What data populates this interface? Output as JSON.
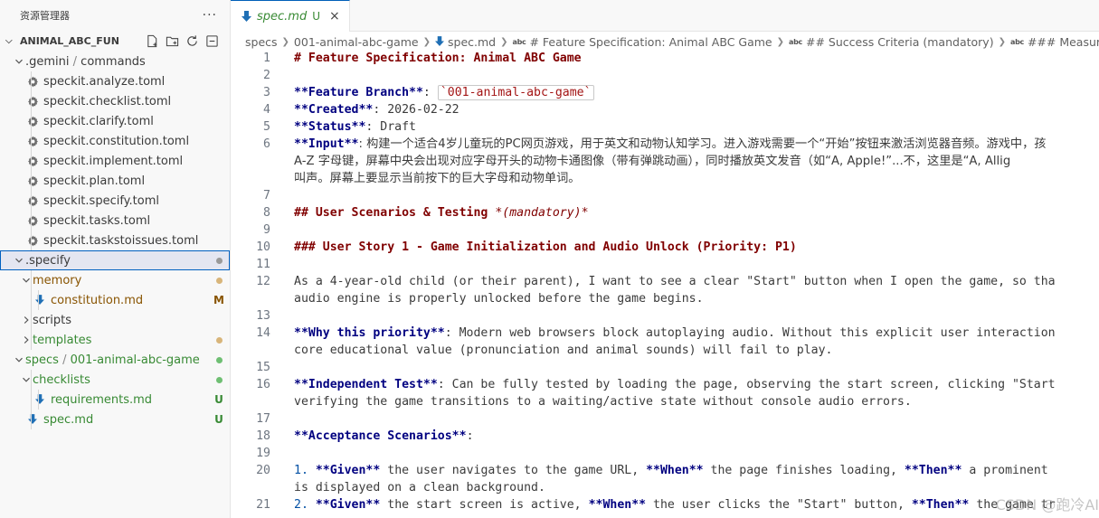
{
  "explorer": {
    "title": "资源管理器",
    "more": "···",
    "root": "ANIMAL_ABC_FUN",
    "tree": [
      {
        "label": ".gemini",
        "label2": "commands",
        "type": "folder",
        "open": true,
        "depth": 1,
        "color": "",
        "badge": ""
      },
      {
        "label": "speckit.analyze.toml",
        "type": "gear",
        "depth": 2
      },
      {
        "label": "speckit.checklist.toml",
        "type": "gear",
        "depth": 2
      },
      {
        "label": "speckit.clarify.toml",
        "type": "gear",
        "depth": 2
      },
      {
        "label": "speckit.constitution.toml",
        "type": "gear",
        "depth": 2
      },
      {
        "label": "speckit.implement.toml",
        "type": "gear",
        "depth": 2
      },
      {
        "label": "speckit.plan.toml",
        "type": "gear",
        "depth": 2
      },
      {
        "label": "speckit.specify.toml",
        "type": "gear",
        "depth": 2
      },
      {
        "label": "speckit.tasks.toml",
        "type": "gear",
        "depth": 2
      },
      {
        "label": "speckit.taskstoissues.toml",
        "type": "gear",
        "depth": 2
      },
      {
        "label": ".specify",
        "type": "folder",
        "open": true,
        "depth": 1,
        "selected": true,
        "dot": "gray"
      },
      {
        "label": "memory",
        "type": "folder",
        "open": true,
        "depth": 2,
        "color": "orange",
        "dot": "orange"
      },
      {
        "label": "constitution.md",
        "type": "md",
        "depth": 3,
        "color": "orange",
        "badge": "M"
      },
      {
        "label": "scripts",
        "type": "folder",
        "open": false,
        "depth": 2
      },
      {
        "label": "templates",
        "type": "folder",
        "open": false,
        "depth": 2,
        "color": "green",
        "dot": "orange"
      },
      {
        "label": "specs",
        "label2": "001-animal-abc-game",
        "type": "folder",
        "open": true,
        "depth": 1,
        "color": "green",
        "dot": "green"
      },
      {
        "label": "checklists",
        "type": "folder",
        "open": true,
        "depth": 2,
        "color": "green",
        "dot": "green"
      },
      {
        "label": "requirements.md",
        "type": "md",
        "depth": 3,
        "color": "green",
        "badge": "U"
      },
      {
        "label": "spec.md",
        "type": "md",
        "depth": 2,
        "color": "green",
        "badge": "U"
      }
    ]
  },
  "tab": {
    "name": "spec.md",
    "status": "U",
    "close": "×"
  },
  "breadcrumb": {
    "specs": "specs",
    "folder": "001-animal-abc-game",
    "file": "spec.md",
    "abc": "abc",
    "h1": "# Feature Specification: Animal ABC Game",
    "h2": "## Success Criteria (mandatory)",
    "h3": "### Measurable Outcomes"
  },
  "editor": {
    "l1": "# Feature Specification: Animal ABC Game",
    "l3a": "**Feature Branch**",
    "l3b": ": ",
    "l3c": "`001-animal-abc-game`",
    "l4a": "**Created**",
    "l4b": ": 2026-02-22",
    "l5a": "**Status**",
    "l5b": ": Draft",
    "l6a": "**Input**",
    "l6b": ": 构建一个适合4岁儿童玩的PC网页游戏，用于英文和动物认知学习。进入游戏需要一个“开始”按钮来激活浏览器音频。游戏中，孩",
    "l6c": "A-Z 字母键，屏幕中央会出现对应字母开头的动物卡通图像（带有弹跳动画），同时播放英文发音（如“A, Apple!”...不，这里是“A, Allig",
    "l6d": "叫声。屏幕上要显示当前按下的巨大字母和动物单词。",
    "l8a": "## User Scenarios & Testing ",
    "l8b": "*(mandatory)*",
    "l10": "### User Story 1 - Game Initialization and Audio Unlock (Priority: P1)",
    "l12a": "As a 4-year-old child (or their parent), I want to see a clear \"Start\" button when I open the game, so tha",
    "l12b": "audio engine is properly unlocked before the game begins.",
    "l14a": "**Why this priority**",
    "l14b": ": Modern web browsers block autoplaying audio. Without this explicit user interaction",
    "l14c": "core educational value (pronunciation and animal sounds) will fail to play.",
    "l16a": "**Independent Test**",
    "l16b": ": Can be fully tested by loading the page, observing the start screen, clicking \"Start",
    "l16c": "verifying the game transitions to a waiting/active state without console audio errors.",
    "l18a": "**Acceptance Scenarios**",
    "l18b": ":",
    "l20n": "1.",
    "l20g": "**Given**",
    "l20t1": " the user navigates to the game URL, ",
    "l20w": "**When**",
    "l20t2": " the page finishes loading, ",
    "l20th": "**Then**",
    "l20t3": " a prominent",
    "l20b": "is displayed on a clean background.",
    "l21n": "2.",
    "l21g": "**Given**",
    "l21t1": " the start screen is active, ",
    "l21w": "**When**",
    "l21t2": " the user clicks the \"Start\" button, ",
    "l21th": "**Then**",
    "l21t3": " the game tr"
  },
  "line_numbers": [
    "1",
    "2",
    "3",
    "4",
    "5",
    "6",
    "",
    "",
    "7",
    "8",
    "9",
    "10",
    "11",
    "12",
    "",
    "13",
    "14",
    "",
    "15",
    "16",
    "",
    "17",
    "18",
    "19",
    "20",
    "",
    "21"
  ],
  "watermark": "CSDN @跑冷AI"
}
